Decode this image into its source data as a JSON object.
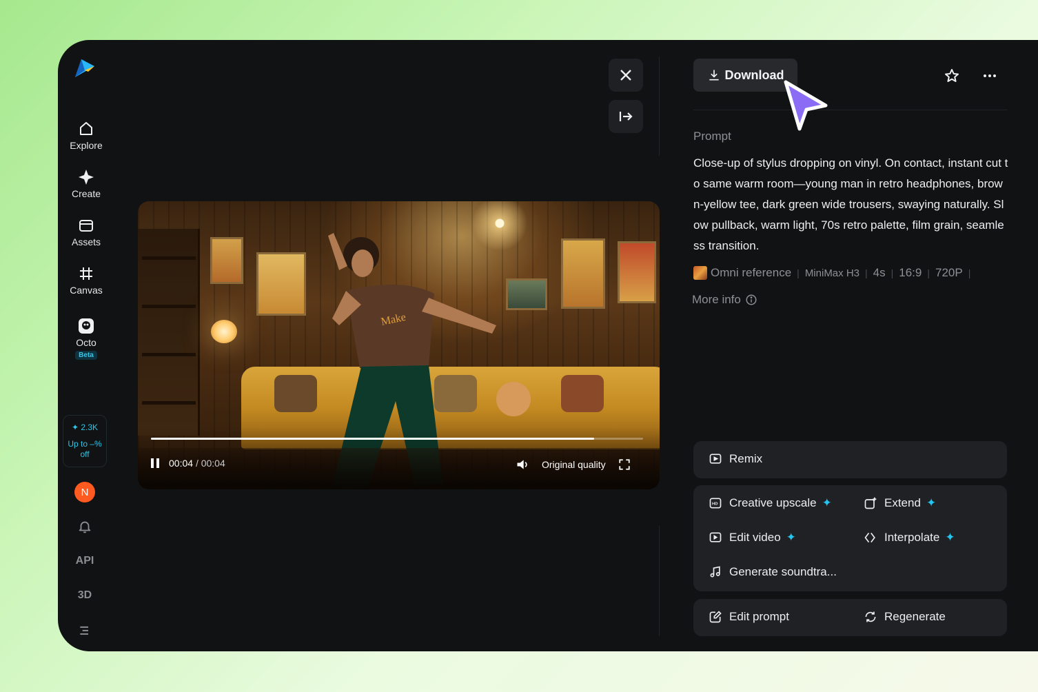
{
  "sidebar": {
    "logo_icon": "paper-plane-logo",
    "items": [
      {
        "label": "Explore",
        "icon": "home-icon"
      },
      {
        "label": "Create",
        "icon": "sparkle-icon"
      },
      {
        "label": "Assets",
        "icon": "folder-icon"
      },
      {
        "label": "Canvas",
        "icon": "canvas-icon"
      },
      {
        "label": "Octo",
        "icon": "octo-icon",
        "badge": "Beta"
      }
    ],
    "credits": {
      "amount": "2.3K",
      "promo_line1": "Up to –%",
      "promo_line2": "off"
    },
    "avatar_initial": "N",
    "api_label": "API",
    "three_d_label": "3D"
  },
  "player": {
    "time_current": "00:04",
    "time_separator": "/",
    "time_total": "00:04",
    "quality_label": "Original quality",
    "progress": 0.9
  },
  "detail": {
    "download_label": "Download",
    "prompt_heading": "Prompt",
    "prompt_text": "Close-up of stylus dropping on vinyl. On contact, instant cut to same warm room—young man in retro headphones, brown-yellow tee, dark green wide trousers, swaying naturally. Slow pullback, warm light, 70s retro palette, film grain, seamless transition.",
    "meta": {
      "reference": "Omni reference",
      "model": "MiniMax H3",
      "duration": "4s",
      "ratio": "16:9",
      "resolution": "720P"
    },
    "more_info_label": "More info"
  },
  "actions": {
    "remix": "Remix",
    "creative_upscale": "Creative upscale",
    "extend": "Extend",
    "edit_video": "Edit video",
    "interpolate": "Interpolate",
    "generate_soundtrack": "Generate soundtra...",
    "edit_prompt": "Edit prompt",
    "regenerate": "Regenerate"
  },
  "colors": {
    "accent": "#23c4ef",
    "cursor": "#8b6cf5",
    "avatar": "#ff5a1f",
    "panel_bg": "#111214"
  }
}
